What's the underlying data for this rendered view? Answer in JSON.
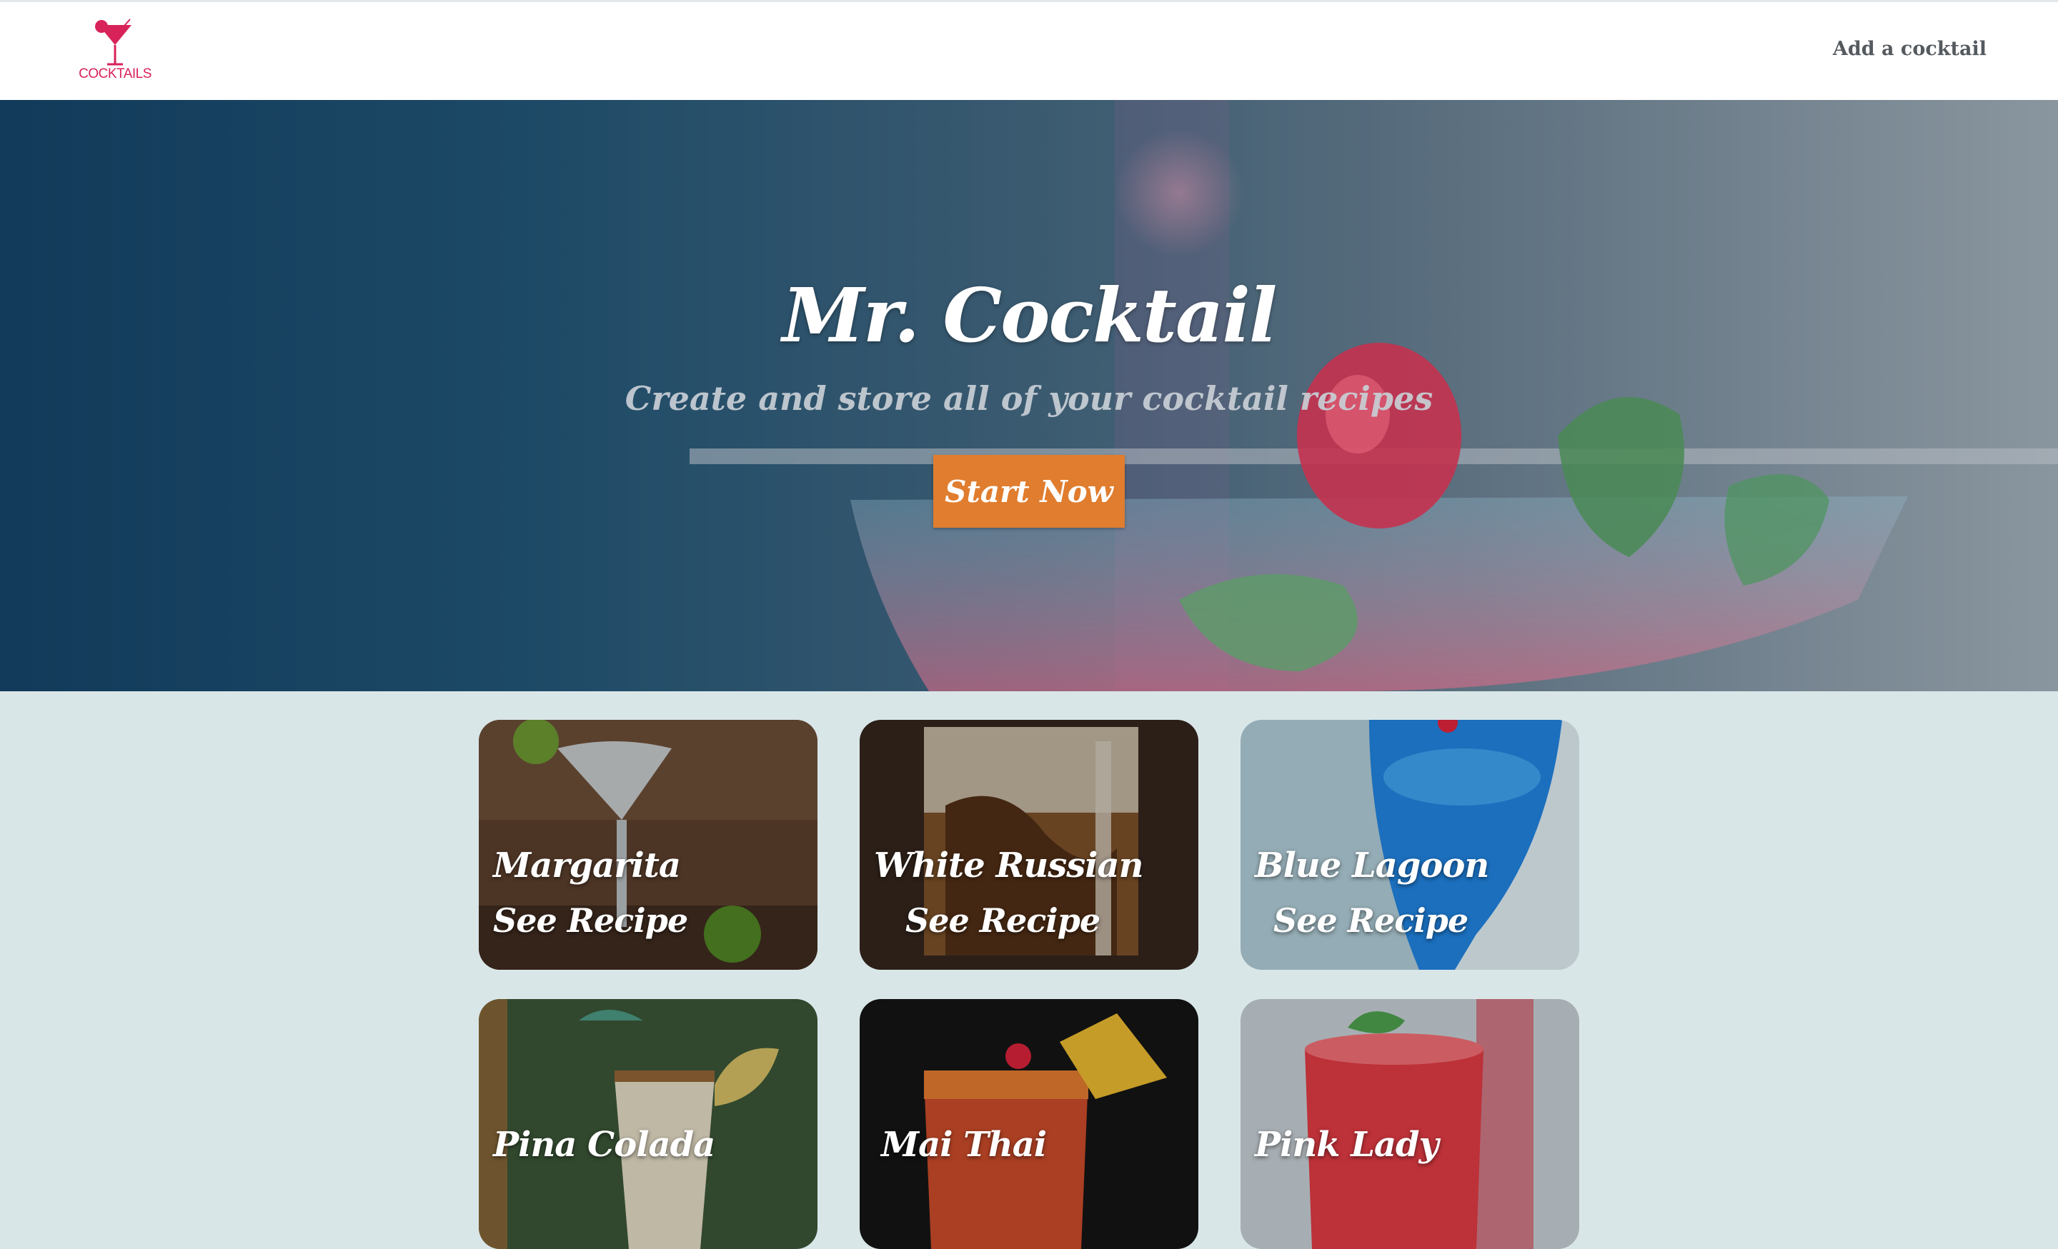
{
  "nav": {
    "logo_text": "COCKTAILS",
    "add_link": "Add a cocktail"
  },
  "hero": {
    "title": "Mr. Cocktail",
    "subtitle": "Create and store all of your cocktail recipes",
    "button": "Start Now"
  },
  "cards": [
    {
      "name": "Margarita",
      "link": "See Recipe"
    },
    {
      "name": "White Russian",
      "link": "See Recipe"
    },
    {
      "name": "Blue Lagoon",
      "link": "See Recipe"
    },
    {
      "name": "Pina Colada"
    },
    {
      "name": "Mai Thai"
    },
    {
      "name": "Pink Lady"
    }
  ],
  "colors": {
    "brand": "#d8235a",
    "button": "#e07d2e",
    "page_bg": "#d9e6e8"
  }
}
